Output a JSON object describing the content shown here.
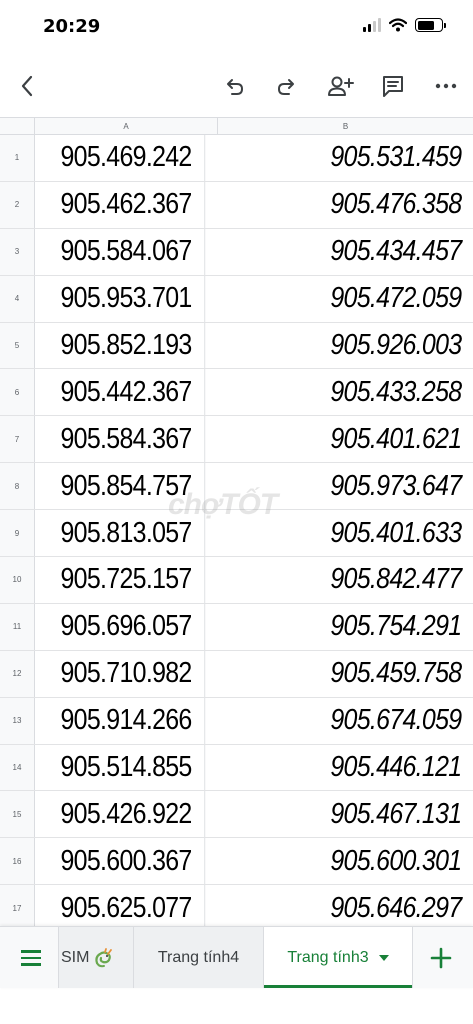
{
  "status": {
    "time": "20:29"
  },
  "toolbar": {
    "back_icon": "chevron-left-icon",
    "undo_icon": "undo-icon",
    "redo_icon": "redo-icon",
    "share_icon": "add-person-icon",
    "comment_icon": "comment-icon",
    "more_icon": "more-horizontal-icon"
  },
  "sheet": {
    "columns": [
      "A",
      "B"
    ],
    "rows": [
      {
        "n": "1",
        "a": "905.469.242",
        "b": "905.531.459"
      },
      {
        "n": "2",
        "a": "905.462.367",
        "b": "905.476.358"
      },
      {
        "n": "3",
        "a": "905.584.067",
        "b": "905.434.457"
      },
      {
        "n": "4",
        "a": "905.953.701",
        "b": "905.472.059"
      },
      {
        "n": "5",
        "a": "905.852.193",
        "b": "905.926.003"
      },
      {
        "n": "6",
        "a": "905.442.367",
        "b": "905.433.258"
      },
      {
        "n": "7",
        "a": "905.584.367",
        "b": "905.401.621"
      },
      {
        "n": "8",
        "a": "905.854.757",
        "b": "905.973.647"
      },
      {
        "n": "9",
        "a": "905.813.057",
        "b": "905.401.633"
      },
      {
        "n": "10",
        "a": "905.725.157",
        "b": "905.842.477"
      },
      {
        "n": "11",
        "a": "905.696.057",
        "b": "905.754.291"
      },
      {
        "n": "12",
        "a": "905.710.982",
        "b": "905.459.758"
      },
      {
        "n": "13",
        "a": "905.914.266",
        "b": "905.674.059"
      },
      {
        "n": "14",
        "a": "905.514.855",
        "b": "905.446.121"
      },
      {
        "n": "15",
        "a": "905.426.922",
        "b": "905.467.131"
      },
      {
        "n": "16",
        "a": "905.600.367",
        "b": "905.600.301"
      },
      {
        "n": "17",
        "a": "905.625.077",
        "b": "905.646.297"
      }
    ]
  },
  "watermark": "chợTỐT",
  "tabs": {
    "sim": "SIM",
    "tab4": "Trang tính4",
    "tab3": "Trang tính3"
  },
  "colors": {
    "accent": "#188038",
    "grid_line": "#dadce0",
    "header_bg": "#f8f9fa"
  }
}
